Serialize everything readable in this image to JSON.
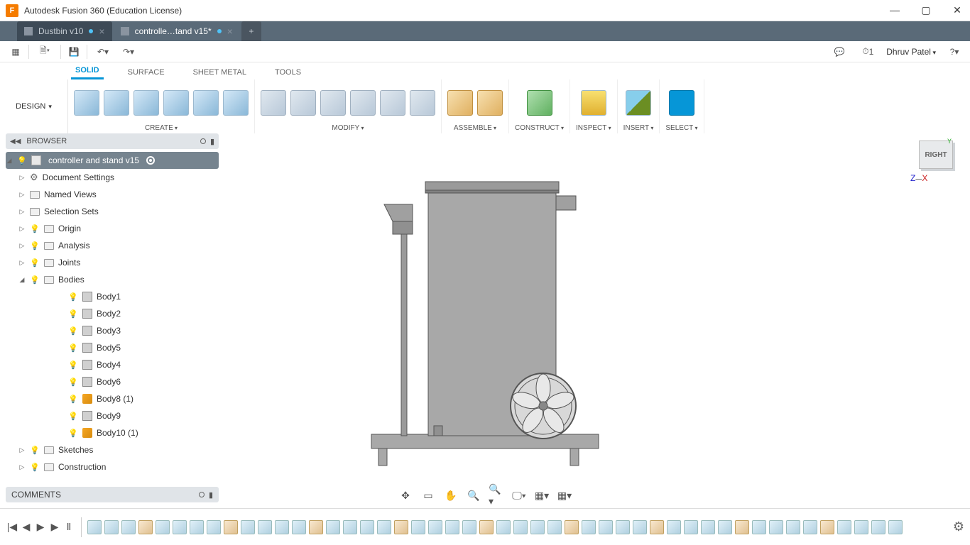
{
  "window": {
    "title": "Autodesk Fusion 360 (Education License)",
    "logo_letter": "F"
  },
  "tabs": [
    {
      "label": "Dustbin v10",
      "active": false
    },
    {
      "label": "controlle…tand v15*",
      "active": true
    }
  ],
  "qat": {
    "update_count": "1"
  },
  "user": {
    "name": "Dhruv Patel"
  },
  "workspace_mode": "DESIGN",
  "ribbon_tabs": [
    {
      "label": "SOLID",
      "active": true
    },
    {
      "label": "SURFACE",
      "active": false
    },
    {
      "label": "SHEET METAL",
      "active": false
    },
    {
      "label": "TOOLS",
      "active": false
    }
  ],
  "ribbon_panels": [
    {
      "label": "CREATE",
      "dropdown": true,
      "icons": 6
    },
    {
      "label": "MODIFY",
      "dropdown": true,
      "icons": 6
    },
    {
      "label": "ASSEMBLE",
      "dropdown": true,
      "icons": 2
    },
    {
      "label": "CONSTRUCT",
      "dropdown": true,
      "icons": 1
    },
    {
      "label": "INSPECT",
      "dropdown": true,
      "icons": 1
    },
    {
      "label": "INSERT",
      "dropdown": true,
      "icons": 1
    },
    {
      "label": "SELECT",
      "dropdown": true,
      "icons": 1
    }
  ],
  "browser": {
    "title": "BROWSER",
    "root": "controller and stand v15",
    "items": [
      {
        "label": "Document Settings",
        "icon": "gear",
        "indent": 1,
        "expand": "▷"
      },
      {
        "label": "Named Views",
        "icon": "folder",
        "indent": 1,
        "expand": "▷"
      },
      {
        "label": "Selection Sets",
        "icon": "folder",
        "indent": 1,
        "expand": "▷"
      },
      {
        "label": "Origin",
        "icon": "folder",
        "indent": 1,
        "expand": "▷",
        "bulb": true
      },
      {
        "label": "Analysis",
        "icon": "folder",
        "indent": 1,
        "expand": "▷",
        "bulb": true
      },
      {
        "label": "Joints",
        "icon": "folder",
        "indent": 1,
        "expand": "▷",
        "bulb": true
      },
      {
        "label": "Bodies",
        "icon": "folder",
        "indent": 1,
        "expand": "◢",
        "bulb": true
      },
      {
        "label": "Body1",
        "icon": "cube",
        "indent": 3,
        "bulb": true
      },
      {
        "label": "Body2",
        "icon": "cube",
        "indent": 3,
        "bulb": true
      },
      {
        "label": "Body3",
        "icon": "cube",
        "indent": 3,
        "bulb": true
      },
      {
        "label": "Body5",
        "icon": "cube",
        "indent": 3,
        "bulb": true
      },
      {
        "label": "Body4",
        "icon": "cube",
        "indent": 3,
        "bulb": true
      },
      {
        "label": "Body6",
        "icon": "cube",
        "indent": 3,
        "bulb": true
      },
      {
        "label": "Body8 (1)",
        "icon": "comp",
        "indent": 3,
        "bulb": true
      },
      {
        "label": "Body9",
        "icon": "cube",
        "indent": 3,
        "bulb": true
      },
      {
        "label": "Body10 (1)",
        "icon": "comp",
        "indent": 3,
        "bulb": true
      },
      {
        "label": "Sketches",
        "icon": "folder",
        "indent": 1,
        "expand": "▷",
        "bulb": true
      },
      {
        "label": "Construction",
        "icon": "folder",
        "indent": 1,
        "expand": "▷",
        "bulb": true
      }
    ]
  },
  "viewcube": {
    "face": "RIGHT",
    "axes": {
      "y": "Y",
      "z": "Z",
      "x": "X"
    }
  },
  "comments": {
    "title": "COMMENTS"
  },
  "timeline_steps": 48
}
